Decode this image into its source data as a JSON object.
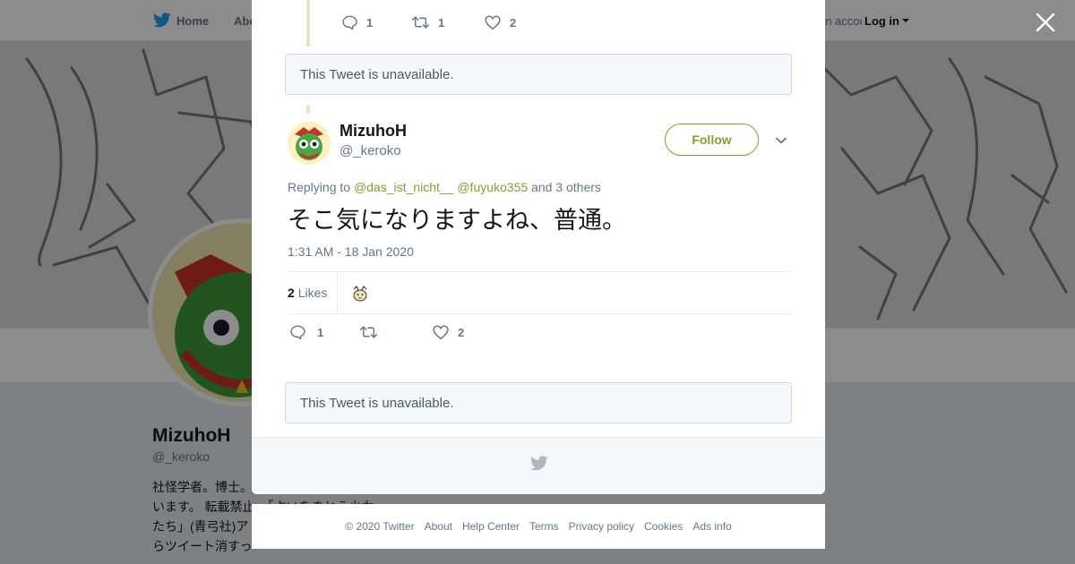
{
  "topnav": {
    "home_label": "Home",
    "about_label": "Abo",
    "account_prompt": "Have an account?",
    "login_label": "Log in"
  },
  "background_profile": {
    "name": "MizuhoH",
    "handle": "@_keroko",
    "bio_lines": [
      "社怪学者。博士。",
      "います。 転載禁止。「占いをまとう少女",
      "たち」(青弓社)ア",
      "らツイート消すっ"
    ]
  },
  "modal": {
    "prev_tweet_actions": {
      "replies": "1",
      "retweets": "1",
      "likes": "2"
    },
    "unavailable_text": "This Tweet is unavailable.",
    "tweet": {
      "author_name": "MizuhoH",
      "author_handle": "@_keroko",
      "follow_label": "Follow",
      "replying_prefix": "Replying to",
      "mention_1": "@das_ist_nicht__",
      "mention_2": "@fuyuko355",
      "replying_suffix": "and 3 others",
      "text": "そこ気になりますよね、普通。",
      "timestamp": "1:31 AM - 18 Jan 2020",
      "likes_count": "2",
      "likes_label": "Likes",
      "actions": {
        "replies": "1",
        "retweets": "",
        "likes": "2"
      }
    },
    "unavailable_text_2": "This Tweet is unavailable."
  },
  "footer": {
    "copyright": "© 2020 Twitter",
    "links": [
      "About",
      "Help Center",
      "Terms",
      "Privacy policy",
      "Cookies",
      "Ads info"
    ]
  },
  "colors": {
    "accent": "#8a9a30",
    "secondary_text": "#657786",
    "unavailable_bg": "#f5f8fa",
    "unavailable_border": "#c9dce8"
  },
  "icons": [
    "twitter-bird-icon",
    "close-icon",
    "reply-icon",
    "retweet-icon",
    "heart-icon",
    "chevron-down-icon"
  ]
}
